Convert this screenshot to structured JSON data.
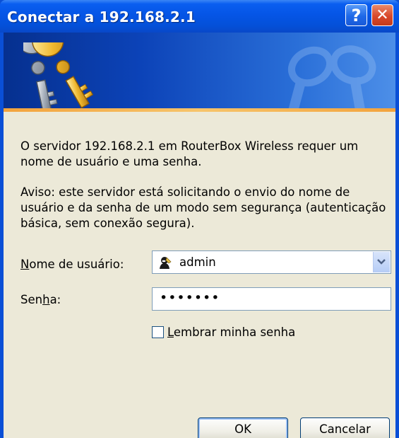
{
  "window": {
    "title": "Conectar a 192.168.2.1",
    "help_button": "?",
    "close_button": "✕"
  },
  "message": {
    "line1": "O servidor 192.168.2.1 em RouterBox Wireless requer um nome de usuário e uma senha.",
    "warning": "Aviso: este servidor está solicitando o envio do nome de usuário e da senha de um modo sem segurança (autenticação básica, sem conexão segura)."
  },
  "form": {
    "username_label_prefix": "",
    "username_label_accel": "N",
    "username_label_rest": "ome de usuário:",
    "username_value": "admin",
    "password_label_prefix": "Sen",
    "password_label_accel": "h",
    "password_label_rest": "a:",
    "password_value": "•••••••",
    "remember_accel": "L",
    "remember_rest": "embrar minha senha",
    "remember_checked": false
  },
  "buttons": {
    "ok": "OK",
    "cancel": "Cancelar"
  },
  "colors": {
    "title_bar": "#0555e6",
    "dialog_background": "#ece9d8",
    "banner_accent": "#f3a33c"
  },
  "icons": {
    "banner": "keys-icon",
    "username_field": "user-icon",
    "dropdown": "chevron-down-icon"
  }
}
